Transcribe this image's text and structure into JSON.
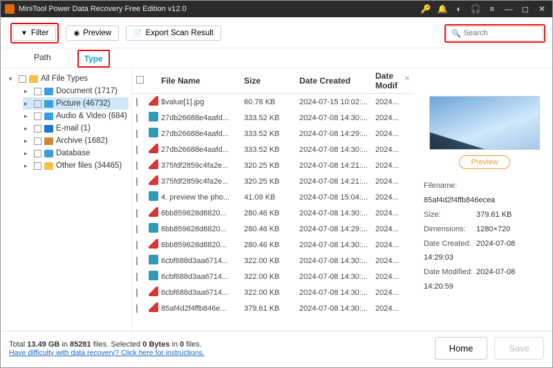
{
  "title": "MiniTool Power Data Recovery Free Edition v12.0",
  "toolbar": {
    "filter": "Filter",
    "preview": "Preview",
    "export": "Export Scan Result",
    "search_placeholder": "Search"
  },
  "tabs": {
    "path": "Path",
    "type": "Type"
  },
  "sidebar": {
    "root": "All File Types",
    "items": [
      {
        "label": "Document (1717)",
        "color": "blue"
      },
      {
        "label": "Picture (46732)",
        "color": "blue",
        "selected": true
      },
      {
        "label": "Audio & Video (684)",
        "color": "blue"
      },
      {
        "label": "E-mail (1)",
        "color": "olk"
      },
      {
        "label": "Archive (1682)",
        "color": "brown"
      },
      {
        "label": "Database",
        "color": "db"
      },
      {
        "label": "Other files (34465)",
        "color": "yellow"
      }
    ]
  },
  "headers": {
    "name": "File Name",
    "size": "Size",
    "dc": "Date Created",
    "dm": "Date Modif"
  },
  "files": [
    {
      "bad": true,
      "name": "$value[1].jpg",
      "size": "60.78 KB",
      "dc": "2024-07-15 10:02:...",
      "dm": "2024..."
    },
    {
      "bad": false,
      "name": "27db26688e4aafd...",
      "size": "333.52 KB",
      "dc": "2024-07-08 14:30:...",
      "dm": "2024..."
    },
    {
      "bad": false,
      "name": "27db26688e4aafd...",
      "size": "333.52 KB",
      "dc": "2024-07-08 14:29:...",
      "dm": "2024..."
    },
    {
      "bad": true,
      "name": "27db26688e4aafd...",
      "size": "333.52 KB",
      "dc": "2024-07-08 14:30:...",
      "dm": "2024..."
    },
    {
      "bad": true,
      "name": "375fdf2859c4fa2e...",
      "size": "320.25 KB",
      "dc": "2024-07-08 14:21:...",
      "dm": "2024..."
    },
    {
      "bad": true,
      "name": "375fdf2859c4fa2e...",
      "size": "320.25 KB",
      "dc": "2024-07-08 14:21:...",
      "dm": "2024..."
    },
    {
      "bad": false,
      "name": "4. preview the pho...",
      "size": "41.09 KB",
      "dc": "2024-07-08 15:04:...",
      "dm": "2024..."
    },
    {
      "bad": true,
      "name": "6bb859628d8820...",
      "size": "280.46 KB",
      "dc": "2024-07-08 14:30:...",
      "dm": "2024..."
    },
    {
      "bad": false,
      "name": "6bb859628d8820...",
      "size": "280.46 KB",
      "dc": "2024-07-08 14:29:...",
      "dm": "2024..."
    },
    {
      "bad": true,
      "name": "6bb859628d8820...",
      "size": "280.46 KB",
      "dc": "2024-07-08 14:30:...",
      "dm": "2024..."
    },
    {
      "bad": false,
      "name": "6cbf688d3aa6714...",
      "size": "322.00 KB",
      "dc": "2024-07-08 14:30:...",
      "dm": "2024..."
    },
    {
      "bad": false,
      "name": "6cbf688d3aa6714...",
      "size": "322.00 KB",
      "dc": "2024-07-08 14:30:...",
      "dm": "2024..."
    },
    {
      "bad": true,
      "name": "6cbf688d3aa6714...",
      "size": "322.00 KB",
      "dc": "2024-07-08 14:30:...",
      "dm": "2024..."
    },
    {
      "bad": true,
      "name": "85af4d2f4ffb846e...",
      "size": "379.61 KB",
      "dc": "2024-07-08 14:30:...",
      "dm": "2024..."
    }
  ],
  "preview": {
    "button": "Preview",
    "meta": {
      "Filename:": "85af4d2f4ffb846ecea",
      "Size:": "379.61 KB",
      "Dimensions:": "1280×720",
      "Date Created:": "2024-07-08 14:29:03",
      "Date Modified:": "2024-07-08 14:20:59"
    }
  },
  "status": {
    "total_label_a": "Total ",
    "total_size": "13.49 GB",
    "total_label_b": " in ",
    "total_files": "85281",
    "total_label_c": " files.",
    "sel_label_a": "   Selected ",
    "sel_bytes": "0 Bytes",
    "sel_label_b": " in ",
    "sel_files": "0",
    "sel_label_c": " files.",
    "link": "Have difficulty with data recovery? Click here for instructions.",
    "home": "Home",
    "save": "Save"
  }
}
